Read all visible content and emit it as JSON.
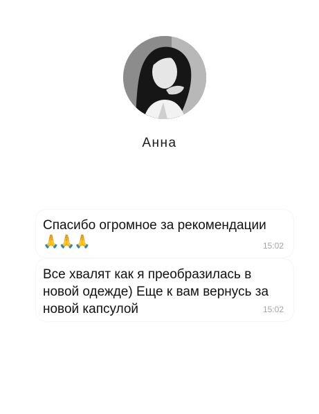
{
  "contact": {
    "name": "Анна",
    "avatar_icon": "person-photo-avatar"
  },
  "messages": [
    {
      "text": "Спасибо огромное за рекомендации",
      "emoji": "🙏🙏🙏",
      "time": "15:02"
    },
    {
      "text": "Все хвалят как я преобразилась в новой одежде) Еще к вам вернусь за новой капсулой",
      "time": "15:02"
    }
  ],
  "colors": {
    "background": "#ffffff",
    "text": "#111111",
    "timestamp": "#a3a3a3"
  }
}
